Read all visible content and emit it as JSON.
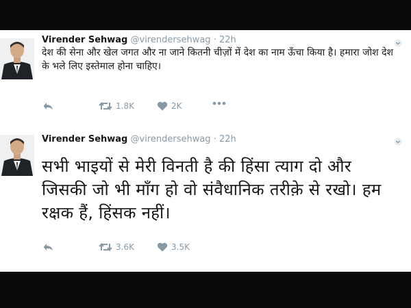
{
  "tweets": [
    {
      "author": "Virender Sehwag",
      "handle": "@virendersehwag",
      "separator": "·",
      "time": "22h",
      "text": "देश की सेना और खेल जगत और ना जाने कितनी चीज़ों में देश का नाम ऊँचा किया है। हमारा जोश देश के भले लिए इस्तेमाल होना चाहिए।",
      "retweets": "1.8K",
      "likes": "2K"
    },
    {
      "author": "Virender Sehwag",
      "handle": "@virendersehwag",
      "separator": "·",
      "time": "22h",
      "text": "सभी भाइयों से मेरी विनती है की हिंसा त्याग दो और जिसकी जो भी माँग हो वो संवैधानिक तरीक़े से रखो। हम रक्षक हैं, हिंसक नहीं।",
      "retweets": "3.6K",
      "likes": "3.5K"
    }
  ],
  "icons": {
    "reply": "reply-icon",
    "retweet": "retweet-icon",
    "like": "heart-icon",
    "more": "more-icon",
    "caret": "chevron-down-icon"
  },
  "colors": {
    "muted": "#8899a6",
    "text": "#14171a",
    "frame": "#0a0a0a"
  }
}
